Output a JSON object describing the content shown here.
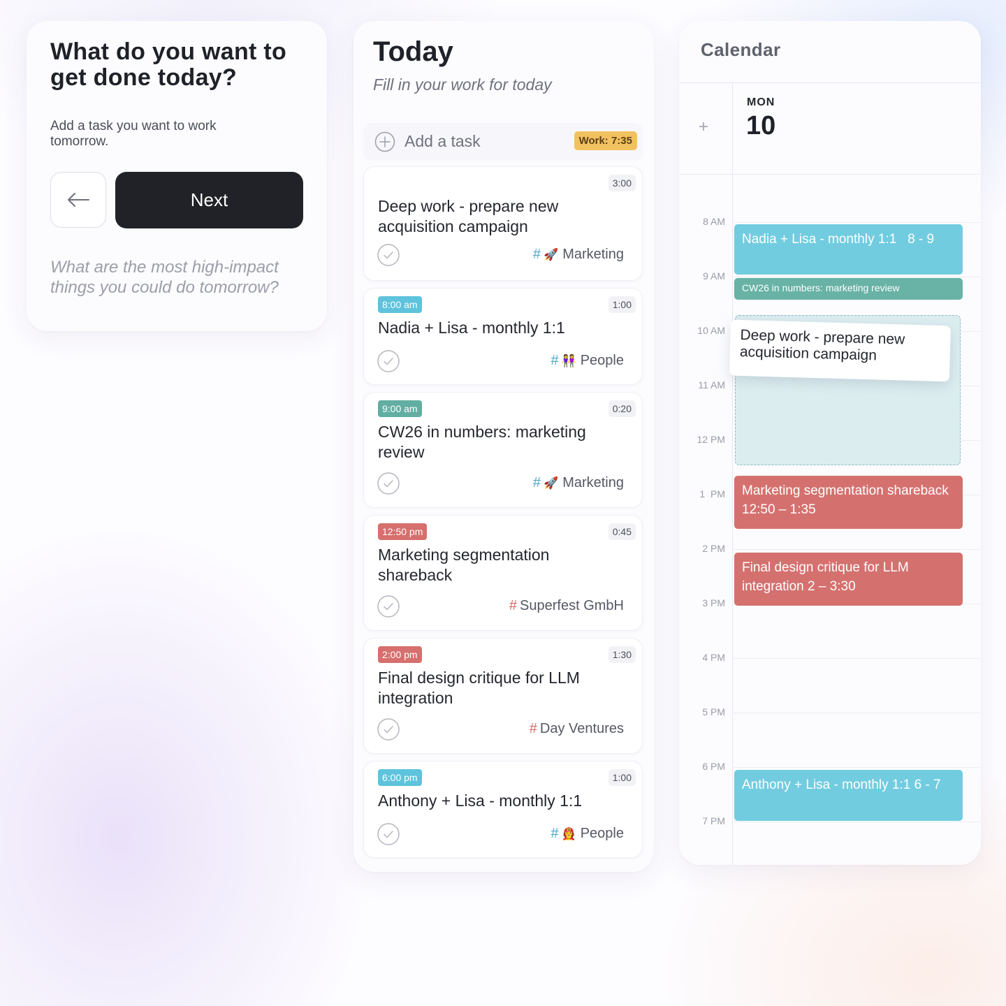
{
  "setup_card": {
    "title": "What do you want to get done today?",
    "subtitle": "Add a task you want to work tomorrow.",
    "back_icon": "arrow-left-icon",
    "next_label": "Next",
    "prompt": "What are the most high-impact things you could do tomorrow?"
  },
  "today": {
    "title": "Today",
    "subtitle": "Fill in your work for today",
    "add_task_label": "Add a task",
    "work_badge": "Work: 7:35",
    "tasks": [
      {
        "time": "",
        "duration": "3:00",
        "title": "Deep work - prepare new acquisition campaign",
        "tag": "Marketing",
        "tag_emoji": "🚀",
        "hash_color": "#4fa8c9"
      },
      {
        "time": "8:00 am",
        "time_color": "#5ec3dc",
        "duration": "1:00",
        "title": "Nadia + Lisa - monthly 1:1",
        "tag": "People",
        "tag_emoji": "👭",
        "hash_color": "#4fa8c9"
      },
      {
        "time": "9:00 am",
        "time_color": "#62aea2",
        "duration": "0:20",
        "title": "CW26 in numbers: marketing review",
        "tag": "Marketing",
        "tag_emoji": "🚀",
        "hash_color": "#4fa8c9"
      },
      {
        "time": "12:50 pm",
        "time_color": "#d66f6d",
        "duration": "0:45",
        "title": "Marketing segmentation shareback",
        "tag": "Superfest GmbH",
        "tag_emoji": "",
        "hash_color": "#d46b69"
      },
      {
        "time": "2:00 pm",
        "time_color": "#d66f6d",
        "duration": "1:30",
        "title": "Final design critique for LLM integration",
        "tag": "Day Ventures",
        "tag_emoji": "",
        "hash_color": "#d46b69"
      },
      {
        "time": "6:00 pm",
        "time_color": "#5ec3dc",
        "duration": "1:00",
        "title": "Anthony + Lisa - monthly 1:1",
        "tag": "People",
        "tag_emoji": "👩‍🚒",
        "hash_color": "#4fa8c9"
      }
    ]
  },
  "calendar": {
    "title": "Calendar",
    "add_symbol": "+",
    "day_name": "MON",
    "day_number": "10",
    "hours": [
      "8 AM",
      "9 AM",
      "10 AM",
      "11 AM",
      "12 PM",
      "1  PM",
      "2 PM",
      "3 PM",
      "4 PM",
      "5 PM",
      "6 PM",
      "7 PM"
    ],
    "events": [
      {
        "label": "Nadia + Lisa - monthly 1:1   8 - 9",
        "color": "#72cce0"
      },
      {
        "label": "CW26 in numbers: marketing review",
        "color": "#68b2a6"
      },
      {
        "label": "Marketing segmentation shareback 12:50 – 1:35",
        "color": "#d4716f"
      },
      {
        "label": "Final design critique for LLM integration 2 – 3:30",
        "color": "#d4716f"
      },
      {
        "label": "Anthony + Lisa - monthly 1:1 6 - 7",
        "color": "#72cce0"
      }
    ],
    "dragging_task": "Deep work - prepare new acquisition campaign"
  },
  "colors": {
    "next_button": "#212227",
    "work_badge": "#f2c160",
    "teal_event": "#72cce0",
    "green_event": "#68b2a6",
    "red_event": "#d4716f",
    "drop_zone": "#dcedf0"
  }
}
